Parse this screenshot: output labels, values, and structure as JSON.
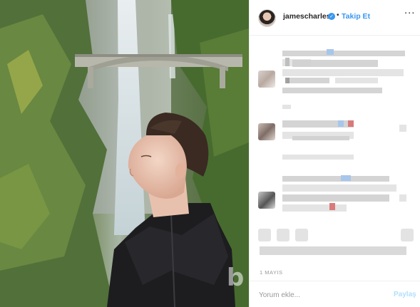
{
  "header": {
    "username": "jamescharles",
    "verified_symbol": "✓",
    "separator": "•",
    "follow_label": "Takip Et",
    "more_symbol": "···"
  },
  "post": {
    "date": "1 MAYIS",
    "comment_placeholder": "Yorum ekle...",
    "post_label": "Paylaş"
  },
  "watermark": {
    "text": "b"
  },
  "colors": {
    "accent": "#3897f0",
    "post_disabled": "#b2dffc",
    "border": "#efefef"
  }
}
